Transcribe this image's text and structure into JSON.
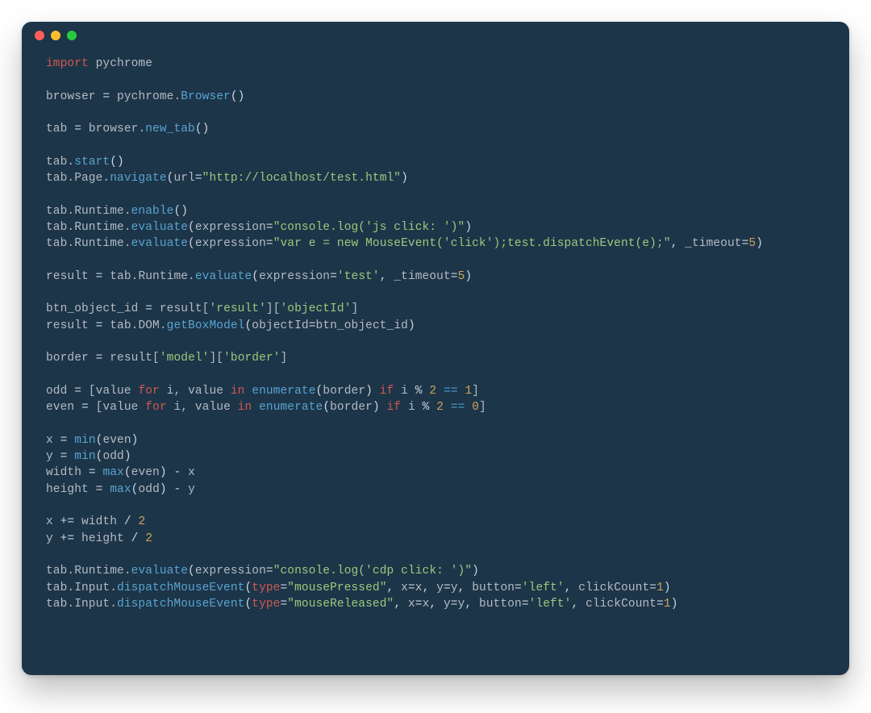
{
  "window": {
    "traffic_lights": [
      "close",
      "minimize",
      "maximize"
    ],
    "background": "#1d3549"
  },
  "code": {
    "language": "python",
    "theme": {
      "keyword": "#d1584f",
      "default": "#c9d1d9",
      "string": "#9aca7c",
      "number": "#cca45a",
      "function": "#58a4d1",
      "compare": "#4aa3d1"
    },
    "tokens": [
      [
        [
          "kw",
          "import"
        ],
        [
          "def",
          " pychrome"
        ]
      ],
      [],
      [
        [
          "def",
          "browser "
        ],
        [
          "op",
          "="
        ],
        [
          "def",
          " pychrome."
        ],
        [
          "fn",
          "Browser"
        ],
        [
          "pun",
          "()"
        ]
      ],
      [],
      [
        [
          "def",
          "tab "
        ],
        [
          "op",
          "="
        ],
        [
          "def",
          " browser."
        ],
        [
          "fn",
          "new_tab"
        ],
        [
          "pun",
          "()"
        ]
      ],
      [],
      [
        [
          "def",
          "tab."
        ],
        [
          "fn",
          "start"
        ],
        [
          "pun",
          "()"
        ]
      ],
      [
        [
          "def",
          "tab.Page."
        ],
        [
          "fn",
          "navigate"
        ],
        [
          "pun",
          "("
        ],
        [
          "def",
          "url"
        ],
        [
          "op",
          "="
        ],
        [
          "str",
          "\"http://localhost/test.html\""
        ],
        [
          "pun",
          ")"
        ]
      ],
      [],
      [
        [
          "def",
          "tab.Runtime."
        ],
        [
          "fn",
          "enable"
        ],
        [
          "pun",
          "()"
        ]
      ],
      [
        [
          "def",
          "tab.Runtime."
        ],
        [
          "fn",
          "evaluate"
        ],
        [
          "pun",
          "("
        ],
        [
          "def",
          "expression"
        ],
        [
          "op",
          "="
        ],
        [
          "str",
          "\"console.log('js click: ')\""
        ],
        [
          "pun",
          ")"
        ]
      ],
      [
        [
          "def",
          "tab.Runtime."
        ],
        [
          "fn",
          "evaluate"
        ],
        [
          "pun",
          "("
        ],
        [
          "def",
          "expression"
        ],
        [
          "op",
          "="
        ],
        [
          "str",
          "\"var e = new MouseEvent('click');test.dispatchEvent(e);\""
        ],
        [
          "pun",
          ", "
        ],
        [
          "def",
          "_timeout"
        ],
        [
          "op",
          "="
        ],
        [
          "num",
          "5"
        ],
        [
          "pun",
          ")"
        ]
      ],
      [],
      [
        [
          "def",
          "result "
        ],
        [
          "op",
          "="
        ],
        [
          "def",
          " tab.Runtime."
        ],
        [
          "fn",
          "evaluate"
        ],
        [
          "pun",
          "("
        ],
        [
          "def",
          "expression"
        ],
        [
          "op",
          "="
        ],
        [
          "str",
          "'test'"
        ],
        [
          "pun",
          ", "
        ],
        [
          "def",
          "_timeout"
        ],
        [
          "op",
          "="
        ],
        [
          "num",
          "5"
        ],
        [
          "pun",
          ")"
        ]
      ],
      [],
      [
        [
          "def",
          "btn_object_id "
        ],
        [
          "op",
          "="
        ],
        [
          "def",
          " result["
        ],
        [
          "str",
          "'result'"
        ],
        [
          "def",
          "]["
        ],
        [
          "str",
          "'objectId'"
        ],
        [
          "def",
          "]"
        ]
      ],
      [
        [
          "def",
          "result "
        ],
        [
          "op",
          "="
        ],
        [
          "def",
          " tab.DOM."
        ],
        [
          "fn",
          "getBoxModel"
        ],
        [
          "pun",
          "("
        ],
        [
          "def",
          "objectId"
        ],
        [
          "op",
          "="
        ],
        [
          "def",
          "btn_object_id"
        ],
        [
          "pun",
          ")"
        ]
      ],
      [],
      [
        [
          "def",
          "border "
        ],
        [
          "op",
          "="
        ],
        [
          "def",
          " result["
        ],
        [
          "str",
          "'model'"
        ],
        [
          "def",
          "]["
        ],
        [
          "str",
          "'border'"
        ],
        [
          "def",
          "]"
        ]
      ],
      [],
      [
        [
          "def",
          "odd "
        ],
        [
          "op",
          "="
        ],
        [
          "def",
          " [value "
        ],
        [
          "kw",
          "for"
        ],
        [
          "def",
          " i, value "
        ],
        [
          "kw",
          "in"
        ],
        [
          "def",
          " "
        ],
        [
          "fn",
          "enumerate"
        ],
        [
          "pun",
          "("
        ],
        [
          "def",
          "border"
        ],
        [
          "pun",
          ") "
        ],
        [
          "kw",
          "if"
        ],
        [
          "def",
          " i "
        ],
        [
          "op",
          "%"
        ],
        [
          "def",
          " "
        ],
        [
          "num",
          "2"
        ],
        [
          "def",
          " "
        ],
        [
          "eq",
          "=="
        ],
        [
          "def",
          " "
        ],
        [
          "num",
          "1"
        ],
        [
          "def",
          "]"
        ]
      ],
      [
        [
          "def",
          "even "
        ],
        [
          "op",
          "="
        ],
        [
          "def",
          " [value "
        ],
        [
          "kw",
          "for"
        ],
        [
          "def",
          " i, value "
        ],
        [
          "kw",
          "in"
        ],
        [
          "def",
          " "
        ],
        [
          "fn",
          "enumerate"
        ],
        [
          "pun",
          "("
        ],
        [
          "def",
          "border"
        ],
        [
          "pun",
          ") "
        ],
        [
          "kw",
          "if"
        ],
        [
          "def",
          " i "
        ],
        [
          "op",
          "%"
        ],
        [
          "def",
          " "
        ],
        [
          "num",
          "2"
        ],
        [
          "def",
          " "
        ],
        [
          "eq",
          "=="
        ],
        [
          "def",
          " "
        ],
        [
          "num",
          "0"
        ],
        [
          "def",
          "]"
        ]
      ],
      [],
      [
        [
          "def",
          "x "
        ],
        [
          "op",
          "="
        ],
        [
          "def",
          " "
        ],
        [
          "fn",
          "min"
        ],
        [
          "pun",
          "("
        ],
        [
          "def",
          "even"
        ],
        [
          "pun",
          ")"
        ]
      ],
      [
        [
          "def",
          "y "
        ],
        [
          "op",
          "="
        ],
        [
          "def",
          " "
        ],
        [
          "fn",
          "min"
        ],
        [
          "pun",
          "("
        ],
        [
          "def",
          "odd"
        ],
        [
          "pun",
          ")"
        ]
      ],
      [
        [
          "def",
          "width "
        ],
        [
          "op",
          "="
        ],
        [
          "def",
          " "
        ],
        [
          "fn",
          "max"
        ],
        [
          "pun",
          "("
        ],
        [
          "def",
          "even"
        ],
        [
          "pun",
          ")"
        ],
        [
          "def",
          " "
        ],
        [
          "op",
          "-"
        ],
        [
          "def",
          " x"
        ]
      ],
      [
        [
          "def",
          "height "
        ],
        [
          "op",
          "="
        ],
        [
          "def",
          " "
        ],
        [
          "fn",
          "max"
        ],
        [
          "pun",
          "("
        ],
        [
          "def",
          "odd"
        ],
        [
          "pun",
          ")"
        ],
        [
          "def",
          " "
        ],
        [
          "op",
          "-"
        ],
        [
          "def",
          " y"
        ]
      ],
      [],
      [
        [
          "def",
          "x "
        ],
        [
          "op",
          "+="
        ],
        [
          "def",
          " width "
        ],
        [
          "op",
          "/"
        ],
        [
          "def",
          " "
        ],
        [
          "num",
          "2"
        ]
      ],
      [
        [
          "def",
          "y "
        ],
        [
          "op",
          "+="
        ],
        [
          "def",
          " height "
        ],
        [
          "op",
          "/"
        ],
        [
          "def",
          " "
        ],
        [
          "num",
          "2"
        ]
      ],
      [],
      [
        [
          "def",
          "tab.Runtime."
        ],
        [
          "fn",
          "evaluate"
        ],
        [
          "pun",
          "("
        ],
        [
          "def",
          "expression"
        ],
        [
          "op",
          "="
        ],
        [
          "str",
          "\"console.log('cdp click: ')\""
        ],
        [
          "pun",
          ")"
        ]
      ],
      [
        [
          "def",
          "tab.Input."
        ],
        [
          "fn",
          "dispatchMouseEvent"
        ],
        [
          "pun",
          "("
        ],
        [
          "kw",
          "type"
        ],
        [
          "op",
          "="
        ],
        [
          "str",
          "\"mousePressed\""
        ],
        [
          "pun",
          ", "
        ],
        [
          "def",
          "x"
        ],
        [
          "op",
          "="
        ],
        [
          "def",
          "x"
        ],
        [
          "pun",
          ", "
        ],
        [
          "def",
          "y"
        ],
        [
          "op",
          "="
        ],
        [
          "def",
          "y"
        ],
        [
          "pun",
          ", "
        ],
        [
          "def",
          "button"
        ],
        [
          "op",
          "="
        ],
        [
          "str",
          "'left'"
        ],
        [
          "pun",
          ", "
        ],
        [
          "def",
          "clickCount"
        ],
        [
          "op",
          "="
        ],
        [
          "num",
          "1"
        ],
        [
          "pun",
          ")"
        ]
      ],
      [
        [
          "def",
          "tab.Input."
        ],
        [
          "fn",
          "dispatchMouseEvent"
        ],
        [
          "pun",
          "("
        ],
        [
          "kw",
          "type"
        ],
        [
          "op",
          "="
        ],
        [
          "str",
          "\"mouseReleased\""
        ],
        [
          "pun",
          ", "
        ],
        [
          "def",
          "x"
        ],
        [
          "op",
          "="
        ],
        [
          "def",
          "x"
        ],
        [
          "pun",
          ", "
        ],
        [
          "def",
          "y"
        ],
        [
          "op",
          "="
        ],
        [
          "def",
          "y"
        ],
        [
          "pun",
          ", "
        ],
        [
          "def",
          "button"
        ],
        [
          "op",
          "="
        ],
        [
          "str",
          "'left'"
        ],
        [
          "pun",
          ", "
        ],
        [
          "def",
          "clickCount"
        ],
        [
          "op",
          "="
        ],
        [
          "num",
          "1"
        ],
        [
          "pun",
          ")"
        ]
      ]
    ]
  }
}
